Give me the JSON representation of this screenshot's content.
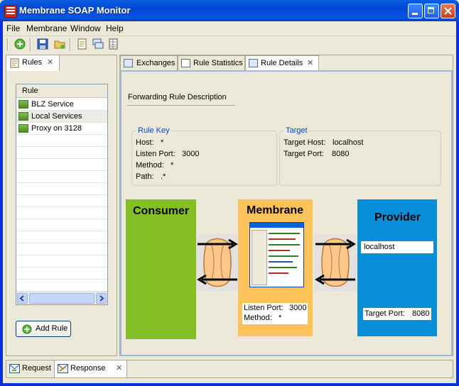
{
  "window": {
    "title": "Membrane SOAP Monitor"
  },
  "menu": {
    "file": "File",
    "membrane": "Membrane",
    "window": "Window",
    "help": "Help"
  },
  "rules_view": {
    "tab_label": "Rules",
    "column_header": "Rule",
    "rules": [
      "BLZ Service",
      "Local Services",
      "Proxy on 3128"
    ],
    "add_rule_label": "Add Rule"
  },
  "tabs": {
    "exchanges": "Exchanges",
    "rule_statistics": "Rule Statistics",
    "rule_details": "Rule Details"
  },
  "rule_details": {
    "heading": "Forwarding Rule Description",
    "rule_key": {
      "legend": "Rule Key",
      "host_label": "Host:",
      "host_value": "*",
      "listen_port_label": "Listen Port:",
      "listen_port_value": "3000",
      "method_label": "Method:",
      "method_value": "*",
      "path_label": "Path:",
      "path_value": ".*"
    },
    "target": {
      "legend": "Target",
      "host_label": "Target Host:",
      "host_value": "localhost",
      "port_label": "Target Port:",
      "port_value": "8080"
    }
  },
  "diagram": {
    "consumer_title": "Consumer",
    "membrane_title": "Membrane",
    "provider_title": "Provider",
    "provider_host": "localhost",
    "membrane_listen_port_label": "Listen Port:",
    "membrane_listen_port_value": "3000",
    "membrane_method_label": "Method:",
    "membrane_method_value": "*",
    "provider_target_port_label": "Target Port:",
    "provider_target_port_value": "8080",
    "colors": {
      "consumer": "#84c025",
      "membrane": "#fdc35a",
      "provider": "#098fd9"
    }
  },
  "bottom_tabs": {
    "request": "Request",
    "response": "Response"
  }
}
